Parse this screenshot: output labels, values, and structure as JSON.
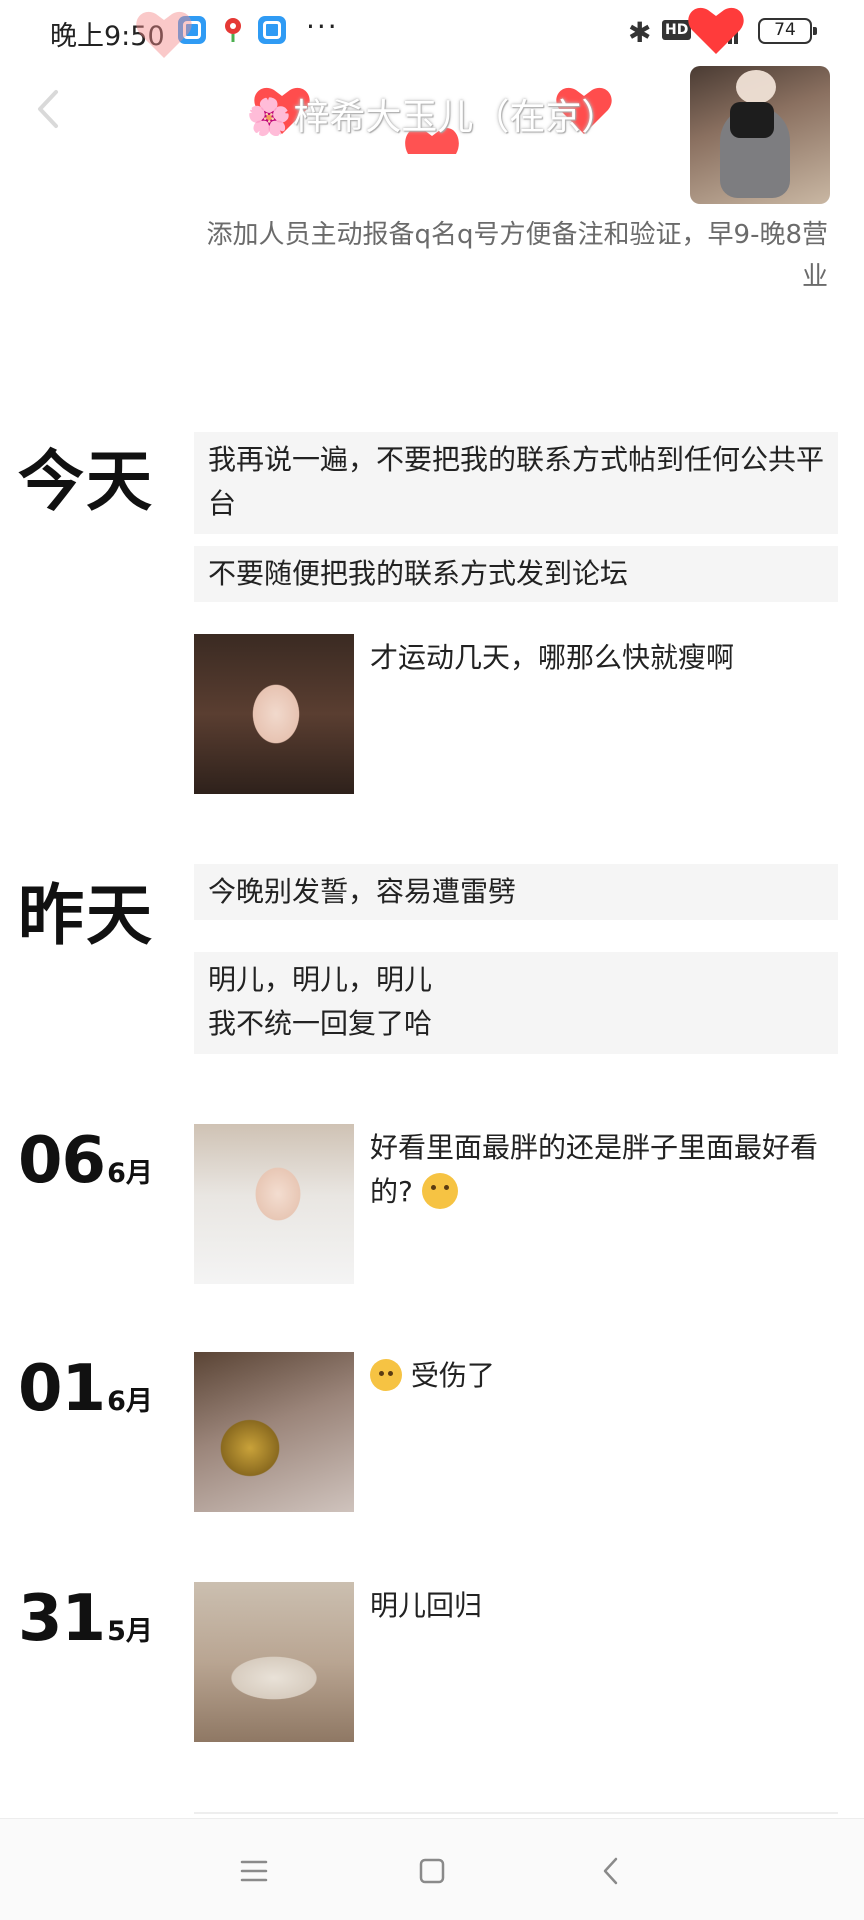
{
  "status_bar": {
    "time": "晚上9:50",
    "dots": "···",
    "bluetooth": "✱",
    "hd": "HD",
    "network": "5G",
    "battery": "74"
  },
  "header": {
    "flower": "🌸",
    "name": "梓希大玉儿（在京）",
    "signature": "添加人员主动报备q名q号方便备注和验证，早9-晚8营业"
  },
  "timeline": {
    "today": {
      "label": "今天",
      "card1": "我再说一遍，不要把我的联系方式帖到任何公共平台",
      "card2": "不要随便把我的联系方式发到论坛",
      "photo_post": "才运动几天，哪那么快就瘦啊"
    },
    "yesterday": {
      "label": "昨天",
      "card1": "今晚别发誓，容易遭雷劈",
      "card2_line1": "明儿，明儿，明儿",
      "card2_line2": "我不统一回复了哈"
    },
    "jun06": {
      "day": "06",
      "month": "6月",
      "text": "好看里面最胖的还是胖子里面最好看的?"
    },
    "jun01": {
      "day": "01",
      "month": "6月",
      "text": "受伤了"
    },
    "may31": {
      "day": "31",
      "month": "5月",
      "text": "明儿回归"
    }
  },
  "icons": {
    "emoji_thinking": "thinking-face-emoji",
    "emoji_injured": "head-bandage-emoji",
    "nav_menu": "menu-icon",
    "nav_home": "home-square-icon",
    "nav_back": "back-chevron-icon"
  }
}
